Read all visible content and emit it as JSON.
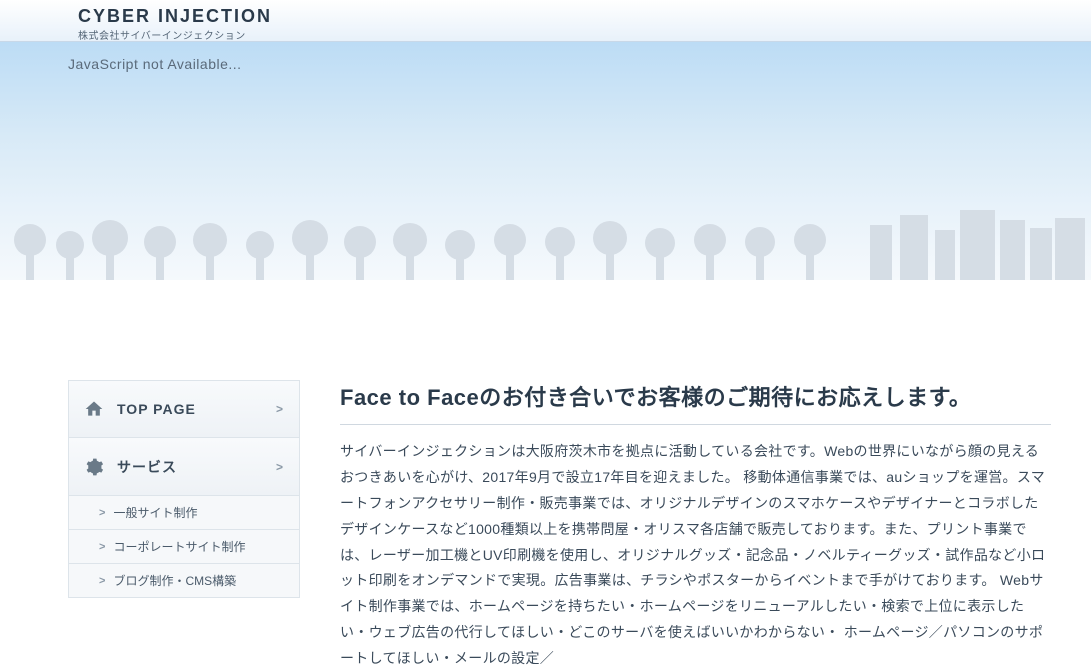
{
  "header": {
    "logo_main": "CYBER INJECTION",
    "logo_sub": "株式会社サイバーインジェクション"
  },
  "hero": {
    "js_msg": "JavaScript not Available..."
  },
  "sidebar": {
    "top": {
      "label": "TOP PAGE"
    },
    "services": {
      "label": "サービス"
    },
    "sub": [
      {
        "label": "一般サイト制作"
      },
      {
        "label": "コーポレートサイト制作"
      },
      {
        "label": "ブログ制作・CMS構築"
      }
    ]
  },
  "main": {
    "headline": "Face to Faceのお付き合いでお客様のご期待にお応えします。",
    "body": "サイバーインジェクションは大阪府茨木市を拠点に活動している会社です。Webの世界にいながら顔の見えるおつきあいを心がけ、2017年9月で設立17年目を迎えました。 移動体通信事業では、auショップを運営。スマートフォンアクセサリー制作・販売事業では、オリジナルデザインのスマホケースやデザイナーとコラボしたデザインケースなど1000種類以上を携帯問屋・オリスマ各店舗で販売しております。また、プリント事業では、レーザー加工機とUV印刷機を使用し、オリジナルグッズ・記念品・ノベルティーグッズ・試作品など小ロット印刷をオンデマンドで実現。広告事業は、チラシやポスターからイベントまで手がけております。 Webサイト制作事業では、ホームページを持ちたい・ホームページをリニューアルしたい・検索で上位に表示したい・ウェブ広告の代行してほしい・どこのサーバを使えばいいかわからない・ ホームページ／パソコンのサポートしてほしい・メールの設定／"
  }
}
